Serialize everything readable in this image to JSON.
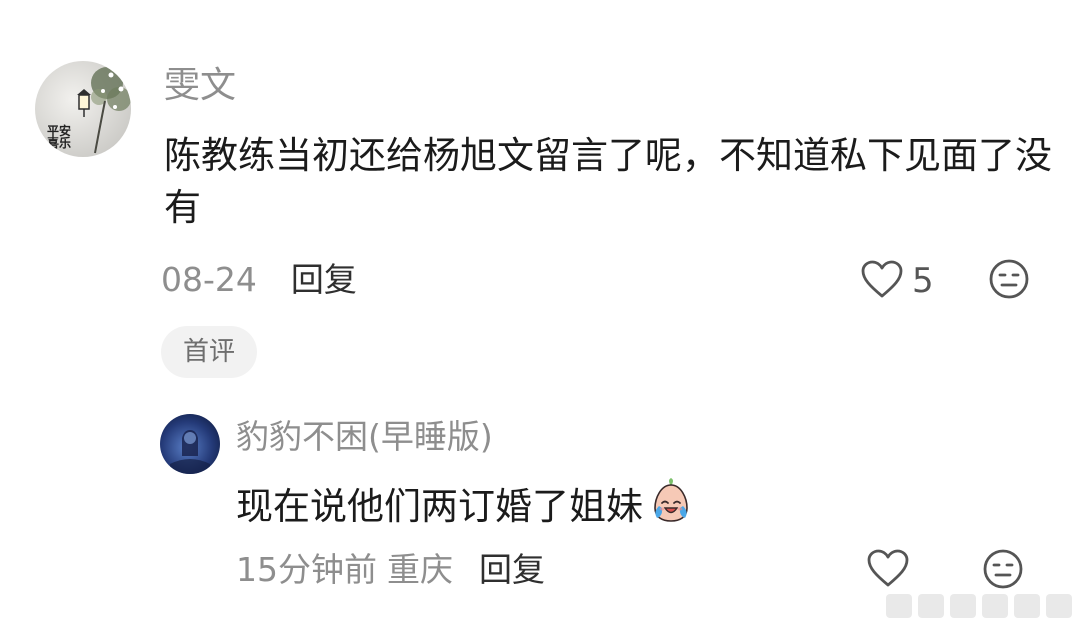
{
  "comment": {
    "user_name": "雯文",
    "text": "陈教练当初还给杨旭文留言了呢，不知道私下见面了没有",
    "date": "08-24",
    "reply_label": "回复",
    "like_count": "5",
    "badge": "首评",
    "avatar_caption": "平安喜乐"
  },
  "reply": {
    "user_name": "豹豹不困(早睡版)",
    "text": "现在说他们两订婚了姐妹",
    "time": "15分钟前",
    "location": "重庆",
    "reply_label": "回复"
  },
  "icons": {
    "like": "heart-icon",
    "dislike": "neutral-face-icon",
    "emoji": "crying-laughing-emoji"
  },
  "colors": {
    "text_primary": "#1b1b1b",
    "text_secondary": "#8e8e8e",
    "badge_bg": "#f2f2f2"
  }
}
